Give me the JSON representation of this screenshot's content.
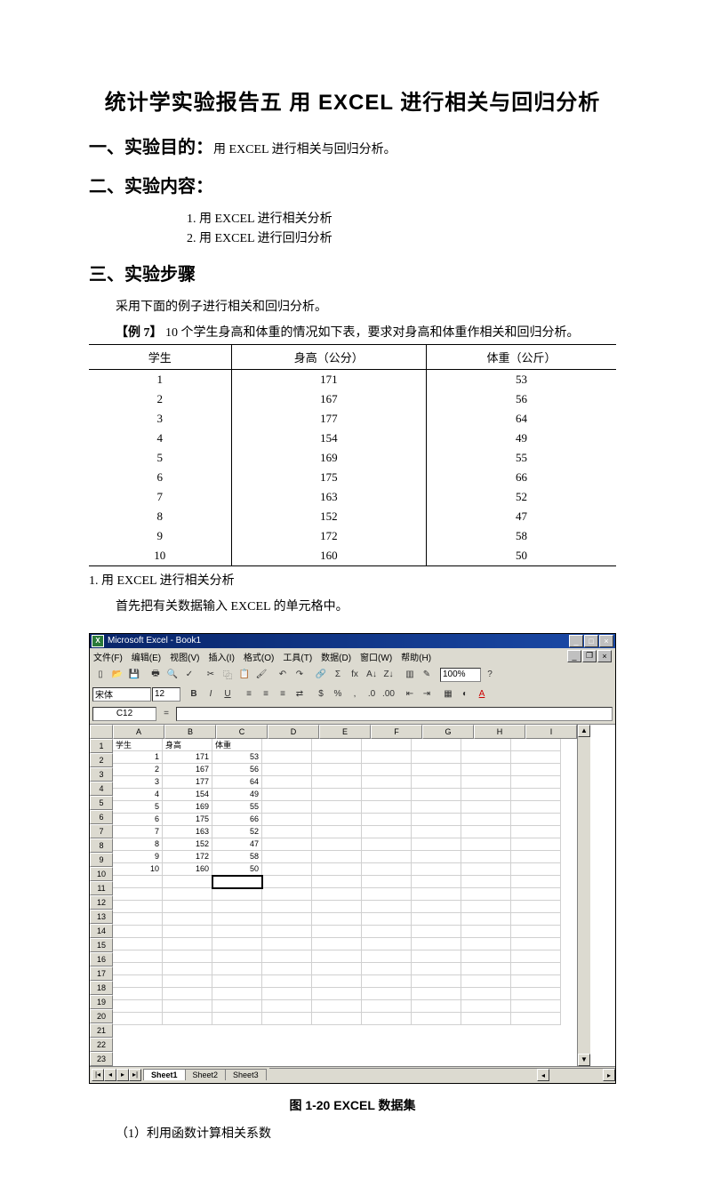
{
  "title": "统计学实验报告五 用 EXCEL 进行相关与回归分析",
  "sections": {
    "s1_head": "一、实验目的：",
    "s1_body": "用 EXCEL 进行相关与回归分析。",
    "s2_head": "二、实验内容：",
    "s2_items": [
      "1. 用 EXCEL 进行相关分析",
      "2. 用 EXCEL 进行回归分析"
    ],
    "s3_head": "三、实验步骤",
    "s3_intro": "采用下面的例子进行相关和回归分析。",
    "example_label": "【例 7】",
    "example_text": " 10 个学生身高和体重的情况如下表，要求对身高和体重作相关和回归分析。",
    "sub1": "1. 用 EXCEL 进行相关分析",
    "sub1_body": "首先把有关数据输入 EXCEL 的单元格中。",
    "fig_caption": "图 1-20    EXCEL 数据集",
    "sub2": "（1）利用函数计算相关系数"
  },
  "table": {
    "headers": [
      "学生",
      "身高（公分）",
      "体重（公斤）"
    ],
    "rows": [
      [
        "1",
        "171",
        "53"
      ],
      [
        "2",
        "167",
        "56"
      ],
      [
        "3",
        "177",
        "64"
      ],
      [
        "4",
        "154",
        "49"
      ],
      [
        "5",
        "169",
        "55"
      ],
      [
        "6",
        "175",
        "66"
      ],
      [
        "7",
        "163",
        "52"
      ],
      [
        "8",
        "152",
        "47"
      ],
      [
        "9",
        "172",
        "58"
      ],
      [
        "10",
        "160",
        "50"
      ]
    ]
  },
  "chart_data": {
    "type": "table",
    "title": "10 个学生身高和体重",
    "columns": [
      "学生",
      "身高（公分）",
      "体重（公斤）"
    ],
    "rows": [
      [
        1,
        171,
        53
      ],
      [
        2,
        167,
        56
      ],
      [
        3,
        177,
        64
      ],
      [
        4,
        154,
        49
      ],
      [
        5,
        169,
        55
      ],
      [
        6,
        175,
        66
      ],
      [
        7,
        163,
        52
      ],
      [
        8,
        152,
        47
      ],
      [
        9,
        172,
        58
      ],
      [
        10,
        160,
        50
      ]
    ]
  },
  "excel": {
    "title": "Microsoft Excel - Book1",
    "menus": [
      "文件(F)",
      "编辑(E)",
      "视图(V)",
      "插入(I)",
      "格式(O)",
      "工具(T)",
      "数据(D)",
      "窗口(W)",
      "帮助(H)"
    ],
    "zoom": "100%",
    "font": "宋体",
    "fontsize": "12",
    "namebox": "C12",
    "cols": [
      "A",
      "B",
      "C",
      "D",
      "E",
      "F",
      "G",
      "H",
      "I"
    ],
    "rows": 23,
    "data_hdr": [
      "学生",
      "身高",
      "体重"
    ],
    "data_rows": [
      [
        "1",
        "171",
        "53"
      ],
      [
        "2",
        "167",
        "56"
      ],
      [
        "3",
        "177",
        "64"
      ],
      [
        "4",
        "154",
        "49"
      ],
      [
        "5",
        "169",
        "55"
      ],
      [
        "6",
        "175",
        "66"
      ],
      [
        "7",
        "163",
        "52"
      ],
      [
        "8",
        "152",
        "47"
      ],
      [
        "9",
        "172",
        "58"
      ],
      [
        "10",
        "160",
        "50"
      ]
    ],
    "sheets": [
      "Sheet1",
      "Sheet2",
      "Sheet3"
    ],
    "active_sheet": 0,
    "selected_cell": "C12"
  }
}
